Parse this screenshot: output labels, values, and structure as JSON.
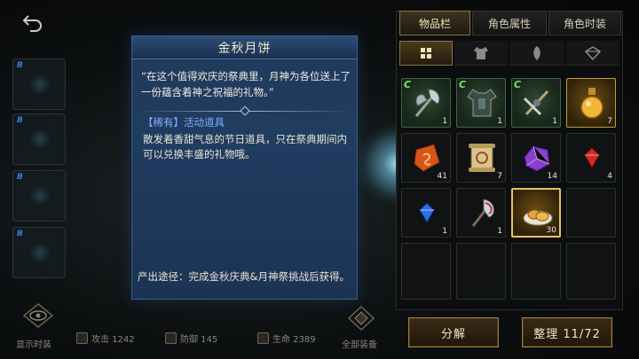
{
  "tooltip": {
    "title": "金秋月饼",
    "quote": "“在这个值得欢庆的祭典里，月神为各位送上了一份蕴含着神之祝福的礼物。”",
    "tag": "【稀有】活动道具",
    "description": "散发着香甜气息的节日道具，只在祭典期间内可以兑换丰盛的礼物哦。",
    "source": "产出途径：完成金秋庆典&月神祭挑战后获得。"
  },
  "tabs": [
    {
      "label": "物品栏",
      "active": true
    },
    {
      "label": "角色属性",
      "active": false
    },
    {
      "label": "角色时装",
      "active": false
    }
  ],
  "subtabs": [
    {
      "icon": "grid-icon",
      "active": true
    },
    {
      "icon": "armor-icon",
      "active": false
    },
    {
      "icon": "feather-icon",
      "active": false
    },
    {
      "icon": "shard-icon",
      "active": false
    }
  ],
  "inventory": [
    {
      "item": "axe-icon",
      "count": "1",
      "tier": "C",
      "bg": "green"
    },
    {
      "item": "armor-icon",
      "count": "1",
      "tier": "C",
      "bg": "green"
    },
    {
      "item": "crossbow-icon",
      "count": "1",
      "tier": "C",
      "bg": "green"
    },
    {
      "item": "potion-icon",
      "count": "7",
      "tier": "",
      "bg": "orange"
    },
    {
      "item": "rune-stone-icon",
      "count": "41",
      "tier": "",
      "bg": "dark"
    },
    {
      "item": "scroll-icon",
      "count": "7",
      "tier": "",
      "bg": "dark"
    },
    {
      "item": "purple-crystal-icon",
      "count": "14",
      "tier": "",
      "bg": "dark"
    },
    {
      "item": "red-gem-icon",
      "count": "4",
      "tier": "",
      "bg": "dark"
    },
    {
      "item": "blue-gem-icon",
      "count": "1",
      "tier": "",
      "bg": "dark"
    },
    {
      "item": "battle-axe-icon",
      "count": "1",
      "tier": "",
      "bg": "dark"
    },
    {
      "item": "mooncake-icon",
      "count": "30",
      "tier": "",
      "bg": "orange",
      "selected": true
    }
  ],
  "buttons": {
    "decompose": "分解",
    "sort": "整理 11/72"
  },
  "bottom": {
    "show_costume": "显示时装",
    "attack": "攻击 1242",
    "defense": "防御 145",
    "life": "生命 2389",
    "all_equip": "全部装备"
  },
  "colors": {
    "accent": "#e8c35c",
    "tooltip_bg": "#1f3a5c",
    "rare_blue": "#7fb0ff"
  }
}
